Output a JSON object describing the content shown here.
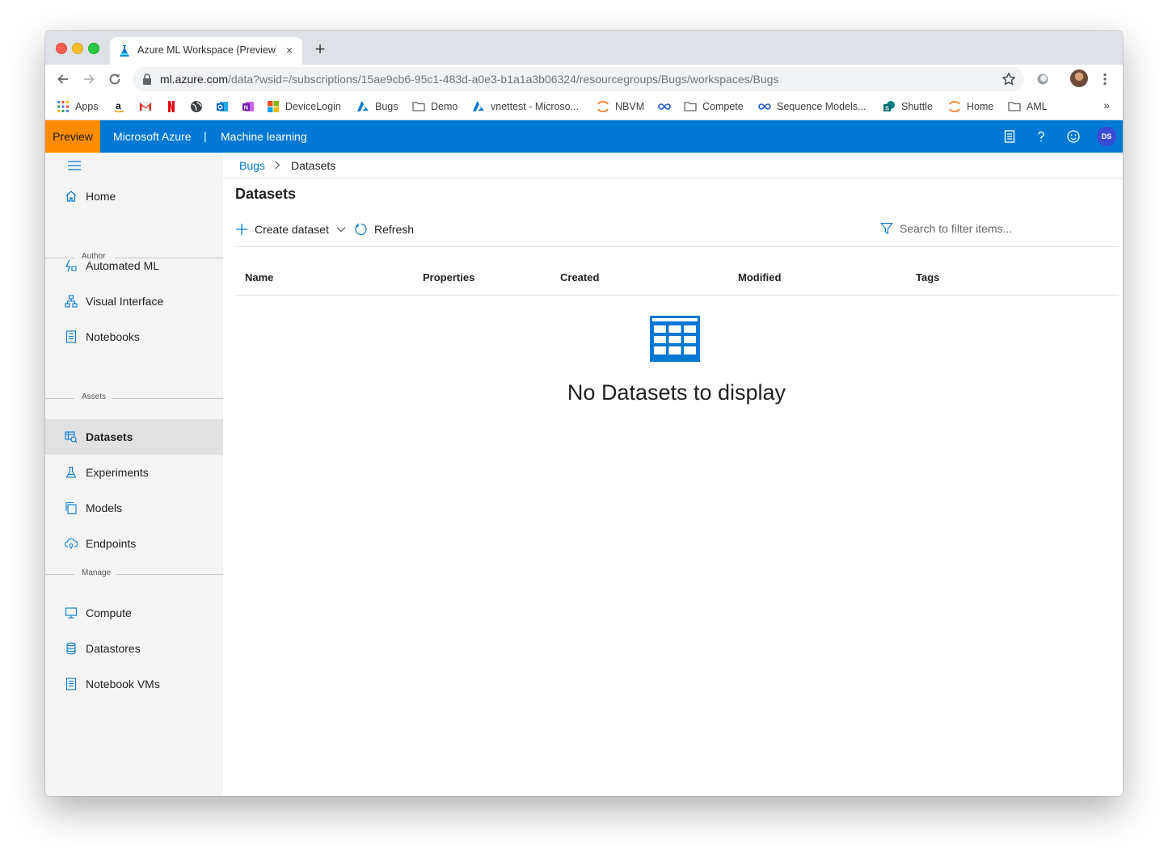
{
  "browser": {
    "tab": {
      "title": "Azure ML Workspace (Preview)",
      "close": "×"
    },
    "new_tab": "+",
    "url": {
      "host": "ml.azure.com",
      "path": "/data?wsid=/subscriptions/15ae9cb6-95c1-483d-a0e3-b1a1a3b06324/resourcegroups/Bugs/workspaces/Bugs"
    },
    "bookmarks": [
      {
        "label": "Apps",
        "icon": "apps-grid-icon"
      },
      {
        "label": "",
        "icon": "amazon-icon"
      },
      {
        "label": "",
        "icon": "gmail-icon"
      },
      {
        "label": "",
        "icon": "netflix-icon"
      },
      {
        "label": "",
        "icon": "globe-icon"
      },
      {
        "label": "",
        "icon": "outlook-icon"
      },
      {
        "label": "",
        "icon": "onenote-icon"
      },
      {
        "label": "DeviceLogin",
        "icon": "microsoft-icon"
      },
      {
        "label": "Bugs",
        "icon": "azure-devops-icon"
      },
      {
        "label": "Demo",
        "icon": "folder-icon"
      },
      {
        "label": "vnettest - Microso...",
        "icon": "azure-icon"
      },
      {
        "label": "NBVM",
        "icon": "jupyter-icon"
      },
      {
        "label": "",
        "icon": "infinity-icon"
      },
      {
        "label": "Compete",
        "icon": "folder-icon"
      },
      {
        "label": "Sequence Models...",
        "icon": "infinity-icon"
      },
      {
        "label": "Shuttle",
        "icon": "sharepoint-icon"
      },
      {
        "label": "Home",
        "icon": "jupyter-icon"
      },
      {
        "label": "AML",
        "icon": "folder-icon"
      }
    ],
    "bookmarks_overflow": "»"
  },
  "header": {
    "preview_badge": "Preview",
    "brand": "Microsoft Azure",
    "separator": "|",
    "product": "Machine learning",
    "avatar_initials": "DS",
    "accent_color": "#0078d4",
    "badge_color": "#ff8c00"
  },
  "sidebar": {
    "home": "Home",
    "sections": [
      {
        "title": "Author",
        "items": [
          "Automated ML",
          "Visual Interface",
          "Notebooks"
        ]
      },
      {
        "title": "Assets",
        "items": [
          "Datasets",
          "Experiments",
          "Models",
          "Endpoints"
        ]
      },
      {
        "title": "Manage",
        "items": [
          "Compute",
          "Datastores",
          "Notebook VMs"
        ]
      }
    ],
    "active_item": "Datasets"
  },
  "main": {
    "breadcrumb": {
      "parent": "Bugs",
      "current": "Datasets"
    },
    "title": "Datasets",
    "commands": {
      "create": "Create dataset",
      "refresh": "Refresh"
    },
    "search_placeholder": "Search to filter items...",
    "columns": [
      "Name",
      "Properties",
      "Created",
      "Modified",
      "Tags"
    ],
    "empty_message": "No Datasets to display"
  }
}
